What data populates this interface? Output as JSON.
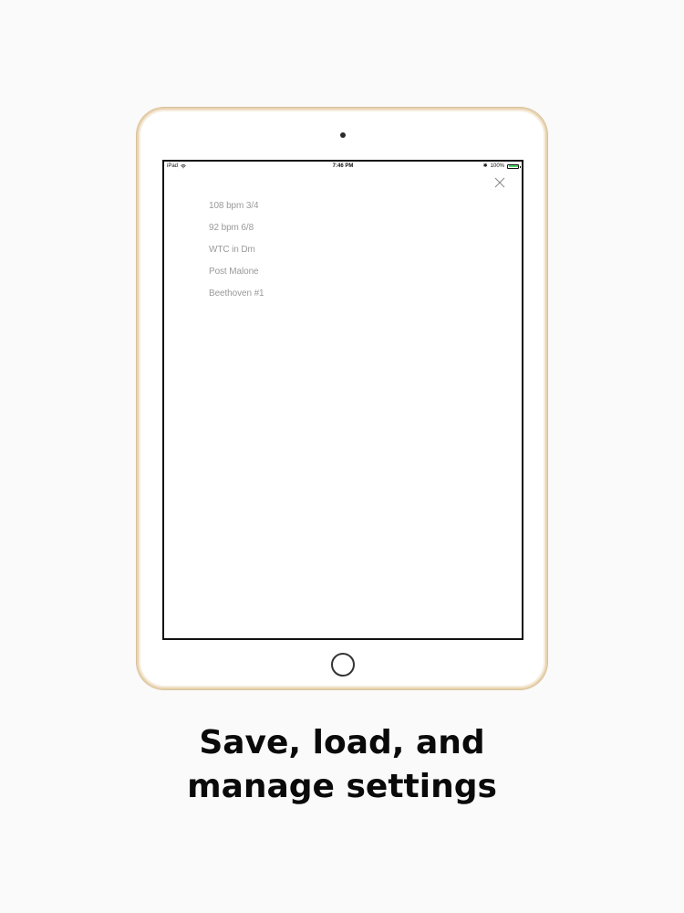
{
  "status_bar": {
    "device": "iPad",
    "wifi_icon": "wifi-icon",
    "time": "7:46 PM",
    "bluetooth_icon": "bluetooth-icon",
    "battery": "100%",
    "battery_color": "#4cd964"
  },
  "close_button": {
    "icon": "close-icon",
    "label": "X"
  },
  "settings": [
    {
      "label": "108 bpm 3/4"
    },
    {
      "label": "92 bpm 6/8"
    },
    {
      "label": "WTC in Dm"
    },
    {
      "label": "Post Malone"
    },
    {
      "label": "Beethoven #1"
    }
  ],
  "caption": {
    "line1": "Save, load, and",
    "line2": "manage settings"
  },
  "colors": {
    "device_frame": "#e8d3b0",
    "list_text": "#9a9a9a",
    "background": "#fafafa"
  }
}
